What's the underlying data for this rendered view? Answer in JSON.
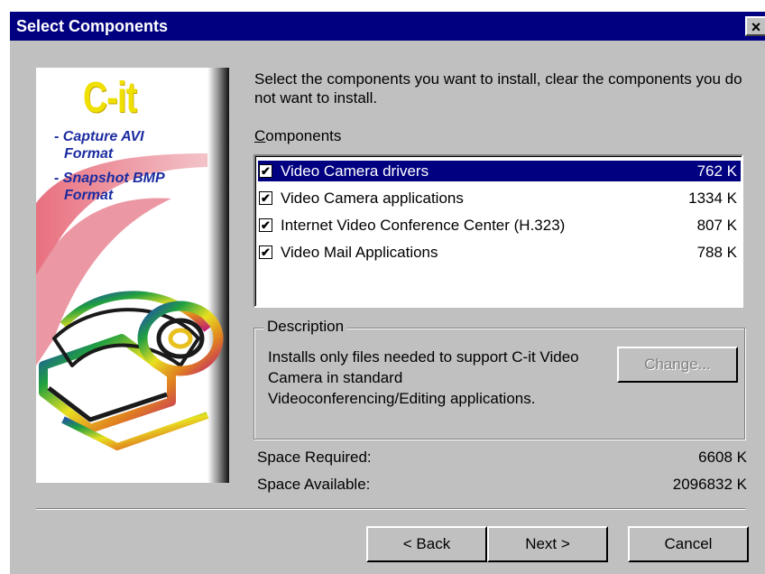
{
  "window": {
    "title": "Select Components",
    "close_label": "×"
  },
  "graphic": {
    "logo": "C-it",
    "features": [
      {
        "line1": "- Capture AVI",
        "line2": "Format"
      },
      {
        "line1": "- Snapshot BMP",
        "line2": "Format"
      }
    ]
  },
  "intro": "Select the components you want to install, clear the components you do not want to install.",
  "components": {
    "label_prefix": "C",
    "label_rest": "omponents",
    "items": [
      {
        "name": "Video Camera drivers",
        "size": "762 K",
        "checked": true,
        "selected": true
      },
      {
        "name": "Video Camera applications",
        "size": "1334 K",
        "checked": true,
        "selected": false
      },
      {
        "name": "Internet Video Conference Center (H.323)",
        "size": "807 K",
        "checked": true,
        "selected": false
      },
      {
        "name": "Video Mail Applications",
        "size": "788 K",
        "checked": true,
        "selected": false
      }
    ]
  },
  "description": {
    "title": "Description",
    "line1": "Installs only files needed to support C-it Video",
    "line2": "Camera in standard",
    "line3": "Videoconferencing/Editing applications.",
    "change_label": "Change..."
  },
  "space": {
    "required_label": "Space Required:",
    "required_value": "6608 K",
    "available_label": "Space Available:",
    "available_value": "2096832 K"
  },
  "buttons": {
    "back": "< Back",
    "next": "Next >",
    "cancel": "Cancel"
  },
  "check_mark": "✔"
}
